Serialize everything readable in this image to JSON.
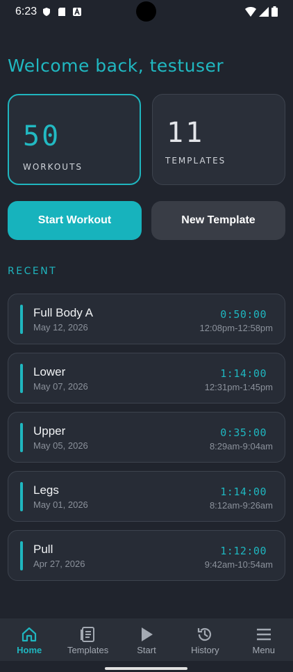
{
  "status": {
    "time": "6:23"
  },
  "welcome": "Welcome back, testuser",
  "stats": [
    {
      "value": "50",
      "label": "WORKOUTS"
    },
    {
      "value": "11",
      "label": "TEMPLATES"
    }
  ],
  "actions": {
    "start_workout": "Start Workout",
    "new_template": "New Template"
  },
  "recent_title": "RECENT",
  "workouts": [
    {
      "name": "Full Body A",
      "date": "May 12, 2026",
      "duration": "0:50:00",
      "range": "12:08pm-12:58pm"
    },
    {
      "name": "Lower",
      "date": "May 07, 2026",
      "duration": "1:14:00",
      "range": "12:31pm-1:45pm"
    },
    {
      "name": "Upper",
      "date": "May 05, 2026",
      "duration": "0:35:00",
      "range": "8:29am-9:04am"
    },
    {
      "name": "Legs",
      "date": "May 01, 2026",
      "duration": "1:14:00",
      "range": "8:12am-9:26am"
    },
    {
      "name": "Pull",
      "date": "Apr 27, 2026",
      "duration": "1:12:00",
      "range": "9:42am-10:54am"
    }
  ],
  "nav": [
    {
      "label": "Home",
      "icon": "home-icon"
    },
    {
      "label": "Templates",
      "icon": "templates-icon"
    },
    {
      "label": "Start",
      "icon": "play-icon"
    },
    {
      "label": "History",
      "icon": "history-icon"
    },
    {
      "label": "Menu",
      "icon": "menu-icon"
    }
  ],
  "colors": {
    "accent": "#1fb6bf",
    "background": "#20242d",
    "card": "#272c36"
  }
}
